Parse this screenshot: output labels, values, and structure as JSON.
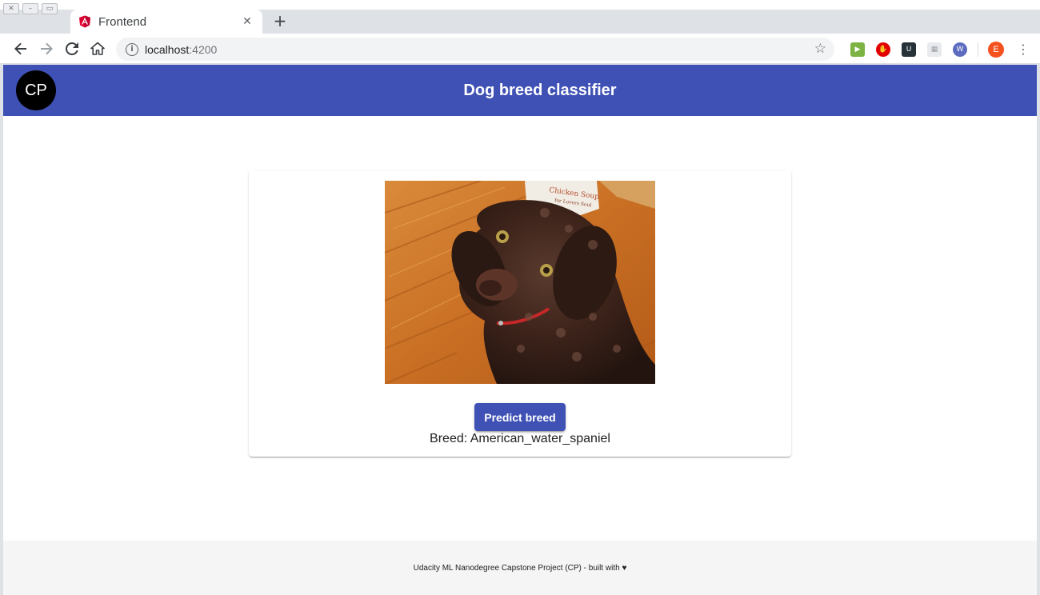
{
  "browser": {
    "tab_title": "Frontend",
    "url_host": "localhost",
    "url_port": ":4200",
    "profile_initial": "E"
  },
  "app": {
    "avatar_text": "CP",
    "title": "Dog breed classifier",
    "predict_label": "Predict breed",
    "breed_prefix": "Breed: ",
    "breed_value": "American_water_spaniel",
    "footer_text": "Udacity ML Nanodegree Capstone Project (CP) - built with ♥"
  },
  "colors": {
    "primary": "#3f51b5",
    "avatar_bg": "#000000",
    "footer_bg": "#f5f5f5",
    "profile": "#f4511e"
  },
  "icons": {
    "back": "arrow-left-icon",
    "forward": "arrow-right-icon",
    "reload": "reload-icon",
    "home": "home-icon",
    "info": "info-icon",
    "star": "star-icon",
    "menu": "kebab-menu-icon"
  }
}
